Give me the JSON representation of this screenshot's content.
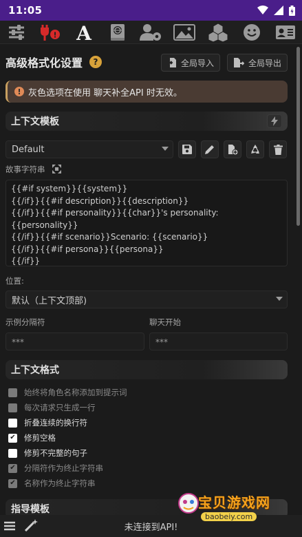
{
  "status": {
    "time": "11:05"
  },
  "topnav": {
    "icons": [
      "sliders-icon",
      "plug-alert-icon",
      "font-a-icon",
      "book-globe-icon",
      "user-gear-icon",
      "image-icon",
      "cubes-icon",
      "smile-icon",
      "id-card-icon"
    ]
  },
  "header": {
    "title": "高级格式化设置",
    "import_label": "全局导入",
    "export_label": "全局导出"
  },
  "warning": {
    "text": "灰色选项在使用 聊天补全API 时无效。"
  },
  "context_template": {
    "section_title": "上下文模板",
    "preset": "Default",
    "story_string_label": "故事字符串",
    "story_string": "{{#if system}}{{system}}\n{{/if}}{{#if description}}{{description}}\n{{/if}}{{#if personality}}{{char}}'s personality: {{personality}}\n{{/if}}{{#if scenario}}Scenario: {{scenario}}\n{{/if}}{{#if persona}}{{persona}}\n{{/if}}",
    "position_label": "位置:",
    "position_value": "默认（上下文顶部)",
    "example_sep_label": "示例分隔符",
    "example_sep_value": "***",
    "chat_start_label": "聊天开始",
    "chat_start_value": "***"
  },
  "context_format": {
    "section_title": "上下文格式",
    "options": [
      {
        "label": "始终将角色名称添加到提示词",
        "state": "disabled"
      },
      {
        "label": "每次请求只生成一行",
        "state": "disabled"
      },
      {
        "label": "折叠连续的换行符",
        "state": "unchecked"
      },
      {
        "label": "修剪空格",
        "state": "checked"
      },
      {
        "label": "修剪不完整的句子",
        "state": "unchecked"
      },
      {
        "label": "分隔符作为终止字符串",
        "state": "disabled-checked"
      },
      {
        "label": "名称作为终止字符串",
        "state": "disabled-checked"
      }
    ]
  },
  "instruct_template": {
    "section_title": "指导模板"
  },
  "bottombar": {
    "status": "未连接到API!"
  },
  "watermark": {
    "text": "宝贝游戏网",
    "url": "baobeiy.com"
  },
  "colors": {
    "statusbar": "#4a1e8a",
    "background": "#1b1b1b",
    "warning_bg": "#4a3b33",
    "help_badge": "#d8a23a"
  }
}
